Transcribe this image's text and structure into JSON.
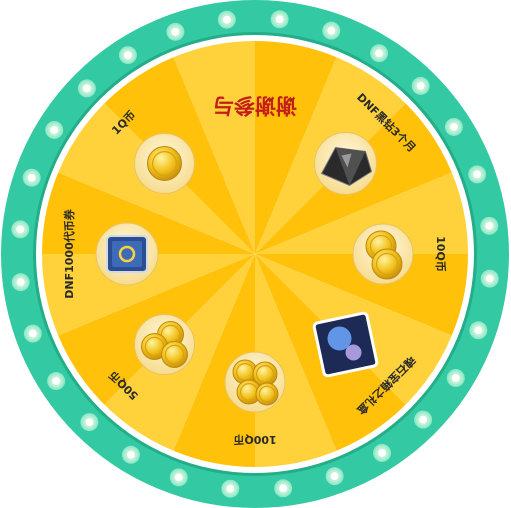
{
  "colors": {
    "ring": "#33c9a2",
    "ring_edge": "#23ad88",
    "light": "#e6ffe2",
    "inner_border": "#ffffff",
    "segment_light": "#ffd23c",
    "segment_dark": "#ffc10a",
    "coin": "#f2c019",
    "coin_edge": "#c08a0b",
    "label_text": "#2a2a2a",
    "thanks_text": "#c41d19"
  },
  "prizes": [
    {
      "label": "谢谢参与",
      "icon": "thanks-text-icon"
    },
    {
      "label": "DNF黑钻3个月",
      "icon": "black-diamond-icon"
    },
    {
      "label": "10Q币",
      "icon": "coin-stack-icon"
    },
    {
      "label": "魂石宝箱之礼盒",
      "icon": "soulstone-box-icon"
    },
    {
      "label": "100Q币",
      "icon": "coin-pile-icon"
    },
    {
      "label": "50Q币",
      "icon": "coin-stack-icon"
    },
    {
      "label": "DNF1000代币券",
      "icon": "token-voucher-icon"
    },
    {
      "label": "1Q币",
      "icon": "coin-icon"
    }
  ]
}
